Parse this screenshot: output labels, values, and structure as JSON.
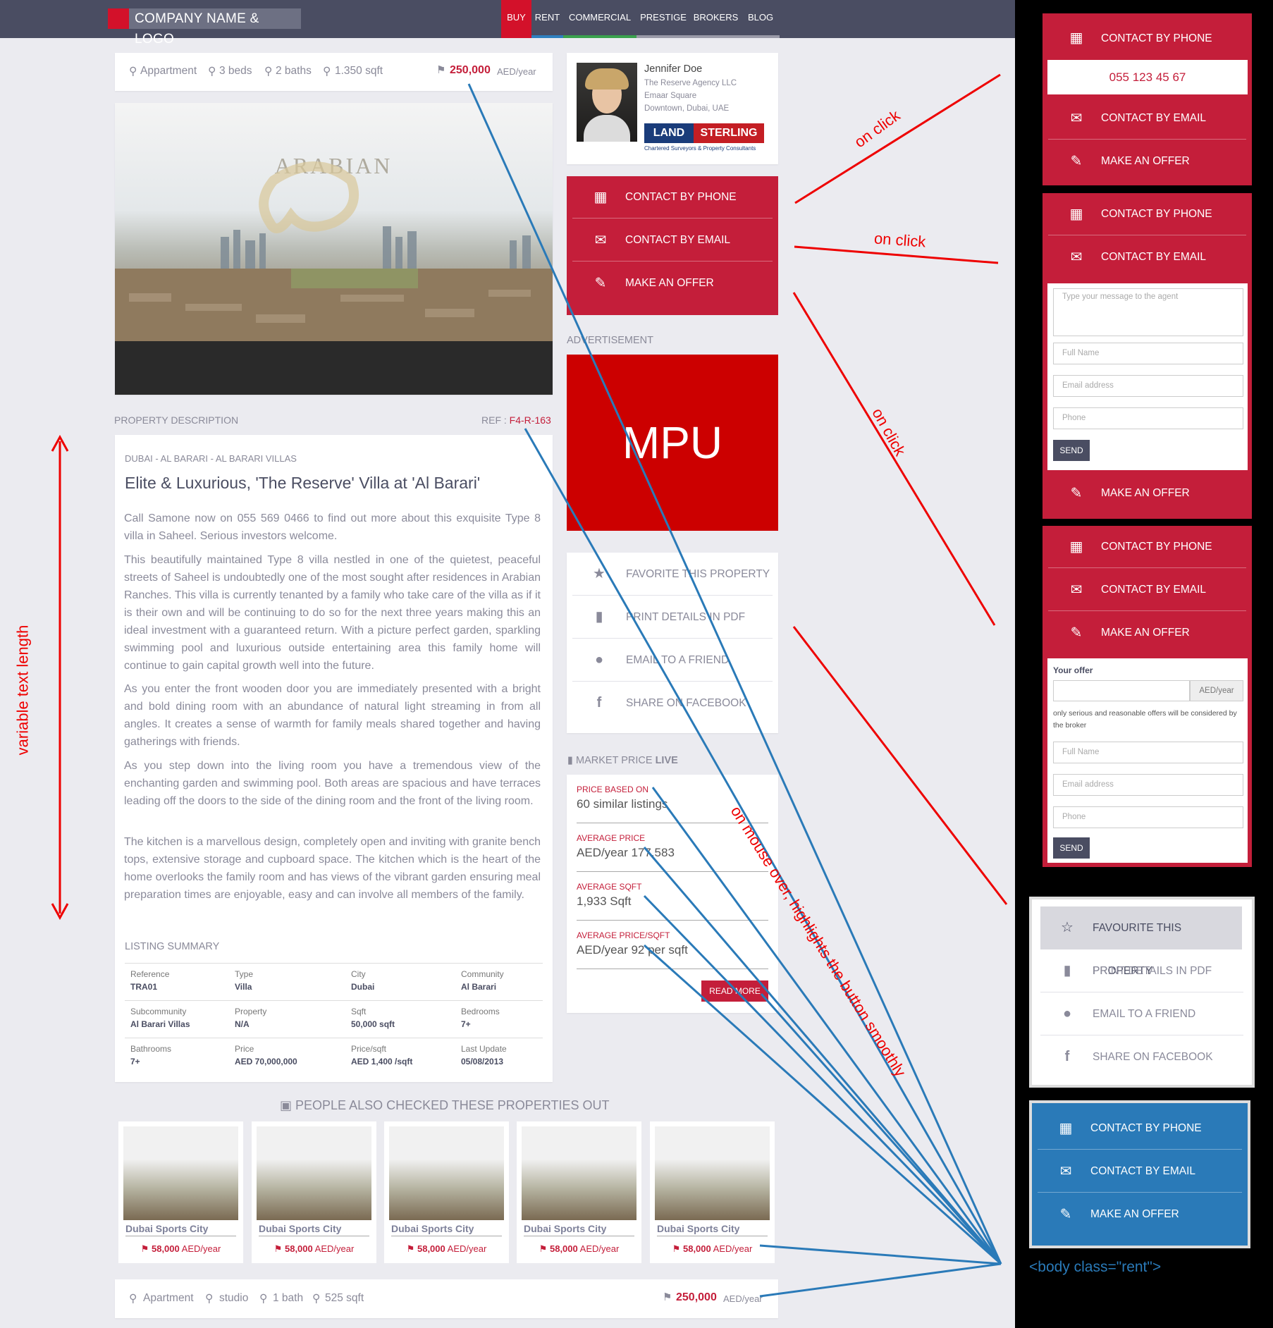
{
  "header": {
    "logo_text": "COMPANY NAME &  LOGO",
    "nav": [
      {
        "label": "BUY",
        "bar_color": "#d3112a"
      },
      {
        "label": "RENT",
        "bar_color": "#2f80c0"
      },
      {
        "label": "COMMERCIAL",
        "bar_color": "#3aa14d"
      },
      {
        "label": "PRESTIGE",
        "bar_color": "#9a9aa8"
      },
      {
        "label": "BROKERS",
        "bar_color": "#9a9aa8"
      },
      {
        "label": "BLOG",
        "bar_color": "#9a9aa8"
      }
    ]
  },
  "summary_bar": {
    "type": "Appartment",
    "beds": "3 beds",
    "baths": "2 baths",
    "sqft": "1.350 sqft",
    "price": "250,000",
    "unit": "AED/year"
  },
  "gallery": {
    "watermark": "ARABIAN"
  },
  "description": {
    "heading": "PROPERTY DESCRIPTION",
    "ref_label": "REF :",
    "ref_value": "F4-R-163",
    "location": "DUBAI - AL BARARI - AL BARARI VILLAS",
    "title": "Elite & Luxurious, 'The Reserve' Villa at 'Al Barari'",
    "paragraphs": [
      "Call Samone now on 055 569 0466 to find out more about this exquisite Type 8 villa in Saheel. Serious investors welcome.",
      "This beautifully maintained Type 8 villa nestled in one of the quietest, peaceful streets of Saheel is undoubtedly one of the most sought after residences in Arabian Ranches. This villa is currently tenanted by a family who take care of the villa as if it is their own and will be continuing to do so for the next three years making this an ideal investment with a guaranteed return. With a picture perfect garden, sparkling swimming pool and luxurious outside entertaining area this family home will continue to gain capital growth well into the future.",
      "As you enter the front wooden door you are immediately presented with a bright and bold dining room with an abundance of natural light streaming in from all angles. It creates a sense of warmth for family meals shared together and having gatherings with friends.",
      "As you step down into the living room you have a tremendous view of the enchanting garden and swimming pool. Both areas are spacious and have terraces leading off the doors to the side of the dining room and the front of the living room.",
      "The kitchen is a marvellous design, completely open and inviting with granite bench tops, extensive storage and cupboard space. The kitchen which is the heart of the home overlooks the family room and has views of the vibrant garden ensuring meal preparation times are enjoyable, easy and can involve all members of the family."
    ],
    "listing_summary_title": "LISTING SUMMARY",
    "listing_summary": [
      [
        {
          "k": "Reference",
          "v": "TRA01"
        },
        {
          "k": "Type",
          "v": "Villa"
        },
        {
          "k": "City",
          "v": "Dubai"
        },
        {
          "k": "Community",
          "v": "Al Barari"
        }
      ],
      [
        {
          "k": "Subcommunity",
          "v": "Al Barari Villas"
        },
        {
          "k": "Property",
          "v": "N/A"
        },
        {
          "k": "Sqft",
          "v": "50,000 sqft"
        },
        {
          "k": "Bedrooms",
          "v": "7+"
        }
      ],
      [
        {
          "k": "Bathrooms",
          "v": "7+"
        },
        {
          "k": "Price",
          "v": "AED 70,000,000"
        },
        {
          "k": "Price/sqft",
          "v": "AED 1,400 /sqft"
        },
        {
          "k": "Last Update",
          "v": "05/08/2013"
        }
      ]
    ]
  },
  "agent": {
    "name": "Jennifer Doe",
    "agency": "The Reserve Agency LLC",
    "address1": "Emaar Square",
    "address2": "Downtown, Dubai, UAE",
    "brand_left": "LAND",
    "brand_right": "STERLING",
    "brand_sub": "Chartered Surveyors & Property Consultants"
  },
  "contact": {
    "phone": "CONTACT BY PHONE",
    "email": "CONTACT BY EMAIL",
    "offer": "MAKE AN OFFER"
  },
  "ad": {
    "label": "ADVERTISEMENT",
    "text": "MPU"
  },
  "actions": {
    "favorite": "FAVORITE THIS PROPERTY",
    "print": "PRINT DETAILS IN PDF",
    "email_friend": "EMAIL TO A FRIEND",
    "share": "SHARE ON FACEBOOK"
  },
  "market": {
    "heading_main": "MARKET PRICE",
    "heading_live": "LIVE",
    "rows": [
      {
        "k": "PRICE BASED ON",
        "v": "60 similar listings"
      },
      {
        "k": "AVERAGE PRICE",
        "v": "AED/year 177,583"
      },
      {
        "k": "AVERAGE SQFT",
        "v": "1,933 Sqft"
      },
      {
        "k": "AVERAGE PRICE/SQFT",
        "v": "AED/year 92 per sqft"
      }
    ],
    "read_more": "READ MORE"
  },
  "similar": {
    "heading": "PEOPLE ALSO CHECKED THESE PROPERTIES OUT",
    "cards": [
      {
        "city": "Dubai Sports City",
        "price": "58,000",
        "unit": "AED/year"
      },
      {
        "city": "Dubai Sports City",
        "price": "58,000",
        "unit": "AED/year"
      },
      {
        "city": "Dubai Sports City",
        "price": "58,000",
        "unit": "AED/year"
      },
      {
        "city": "Dubai Sports City",
        "price": "58,000",
        "unit": "AED/year"
      },
      {
        "city": "Dubai Sports City",
        "price": "58,000",
        "unit": "AED/year"
      }
    ]
  },
  "footer_bar": {
    "type": "Apartment",
    "beds": "studio",
    "baths": "1 bath",
    "sqft": "525 sqft",
    "price": "250,000",
    "unit": "AED/year"
  },
  "right_panels": {
    "phone_number": "055 123 45 67",
    "message_placeholder": "Type your message to the agent",
    "fullname_placeholder": "Full Name",
    "email_placeholder": "Email address",
    "phone_placeholder": "Phone",
    "send": "SEND",
    "your_offer": "Your offer",
    "offer_unit": "AED/year",
    "offer_note": "only serious and reasonable offers will be considered by the broker",
    "favourite": "FAVOURITE THIS PROPERTY"
  },
  "annotations": {
    "on_click": "on click",
    "mouse_over": "on mouse over, highlights the button smoothly",
    "variable_text": "variable text length",
    "body_class": "<body class=\"rent\">"
  }
}
